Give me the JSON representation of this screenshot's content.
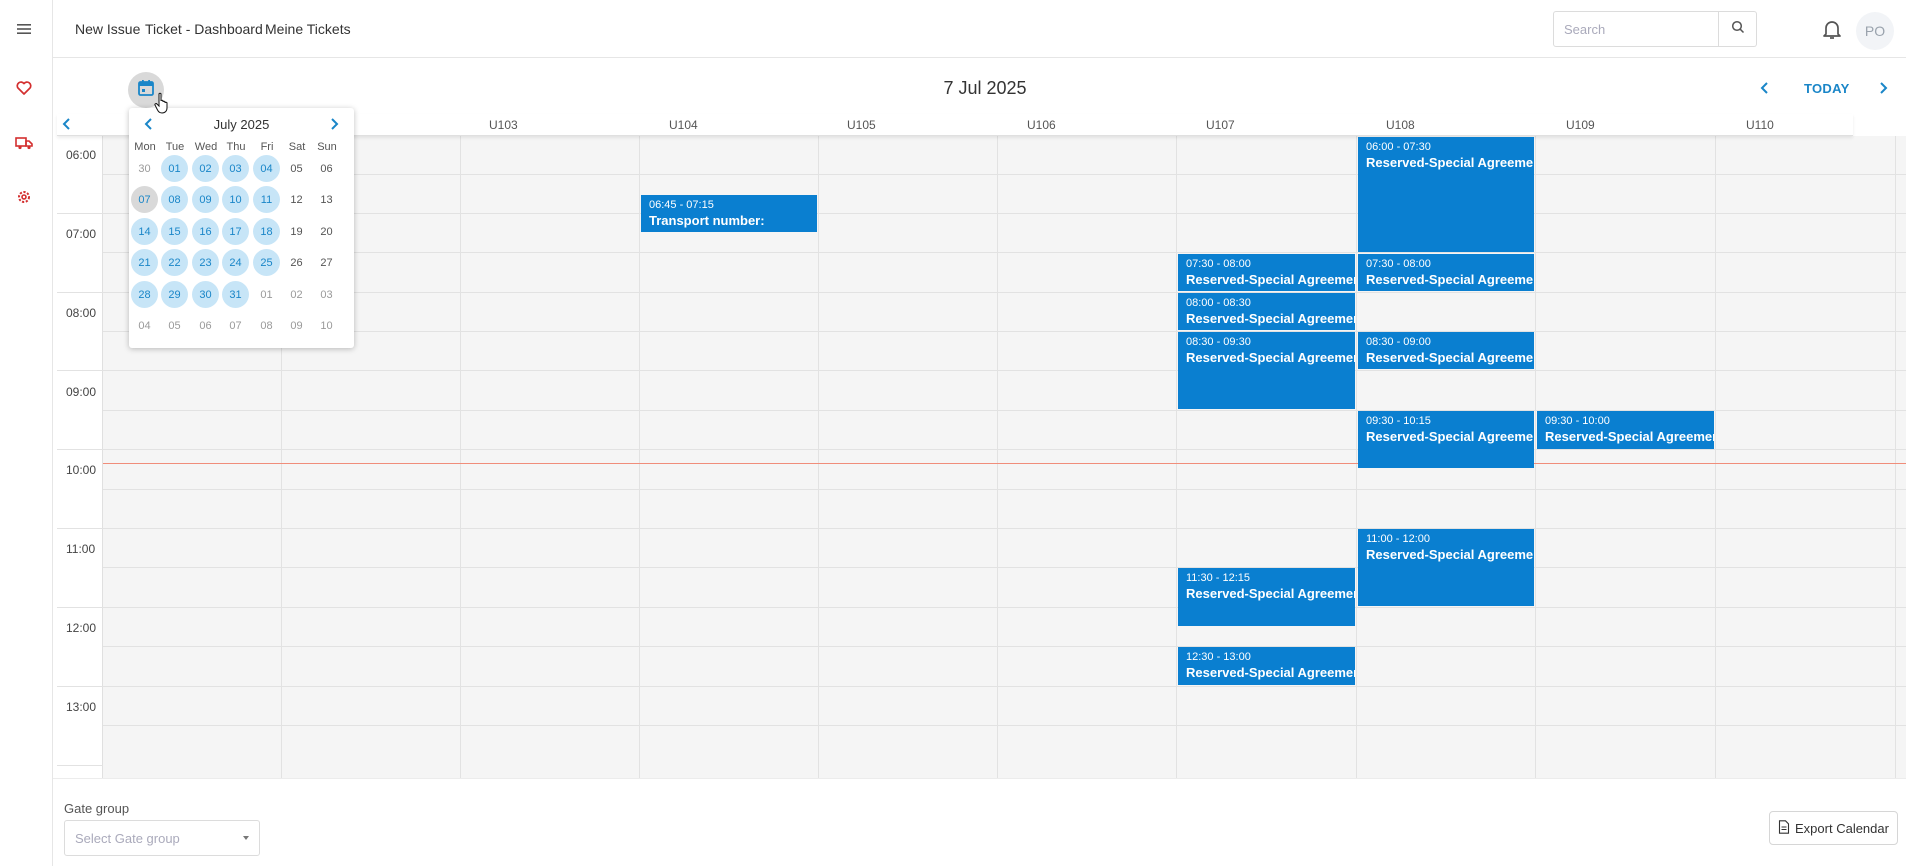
{
  "nav": {
    "links": [
      "New Issue",
      "Ticket - Dashboard",
      "Meine Tickets"
    ],
    "search_placeholder": "Search",
    "avatar_initials": "PO"
  },
  "calendar": {
    "date_title": "7 Jul 2025",
    "today_label": "TODAY",
    "columns": [
      "U103",
      "U104",
      "U105",
      "U106",
      "U107",
      "U108",
      "U109",
      "U110"
    ],
    "times": [
      "06:00",
      "07:00",
      "08:00",
      "09:00",
      "10:00",
      "11:00",
      "12:00",
      "13:00"
    ],
    "events": {
      "e1": {
        "time": "06:45 - 07:15",
        "name": "Transport number:"
      },
      "e2": {
        "time": "06:00 - 07:30",
        "name": "Reserved-Special Agreement"
      },
      "e3": {
        "time": "07:30 - 08:00",
        "name": "Reserved-Special Agreement"
      },
      "e4": {
        "time": "07:30 - 08:00",
        "name": "Reserved-Special Agreement"
      },
      "e5": {
        "time": "08:00 - 08:30",
        "name": "Reserved-Special Agreement"
      },
      "e6": {
        "time": "08:30 - 09:30",
        "name": "Reserved-Special Agreement"
      },
      "e7": {
        "time": "08:30 - 09:00",
        "name": "Reserved-Special Agreement"
      },
      "e8": {
        "time": "09:30 - 10:15",
        "name": "Reserved-Special Agreement"
      },
      "e9": {
        "time": "09:30 - 10:00",
        "name": "Reserved-Special Agreement"
      },
      "e10": {
        "time": "11:00 - 12:00",
        "name": "Reserved-Special Agreement"
      },
      "e11": {
        "time": "11:30 - 12:15",
        "name": "Reserved-Special Agreement"
      },
      "e12": {
        "time": "12:30 - 13:00",
        "name": "Reserved-Special Agreement"
      }
    }
  },
  "datepicker": {
    "title": "July 2025",
    "weekdays": [
      "Mon",
      "Tue",
      "Wed",
      "Thu",
      "Fri",
      "Sat",
      "Sun"
    ],
    "weeks": [
      [
        "30",
        "01",
        "02",
        "03",
        "04",
        "05",
        "06"
      ],
      [
        "07",
        "08",
        "09",
        "10",
        "11",
        "12",
        "13"
      ],
      [
        "14",
        "15",
        "16",
        "17",
        "18",
        "19",
        "20"
      ],
      [
        "21",
        "22",
        "23",
        "24",
        "25",
        "26",
        "27"
      ],
      [
        "28",
        "29",
        "30",
        "31",
        "01",
        "02",
        "03"
      ],
      [
        "04",
        "05",
        "06",
        "07",
        "08",
        "09",
        "10"
      ]
    ],
    "selected_day": "07"
  },
  "footer": {
    "gate_group_label": "Gate group",
    "gate_group_placeholder": "Select Gate group",
    "export_label": "Export Calendar"
  },
  "colors": {
    "event_blue": "#0a7fd0",
    "accent": "#1a86c8",
    "now_line": "#f08d7a",
    "rail_icon_red": "#d32f2f"
  },
  "icons": [
    "menu-icon",
    "heart-icon",
    "truck-icon",
    "gear-icon",
    "search-icon",
    "bell-icon",
    "calendar-icon",
    "chevron-left-icon",
    "chevron-right-icon",
    "document-icon",
    "caret-down-icon",
    "hand-cursor-icon"
  ]
}
